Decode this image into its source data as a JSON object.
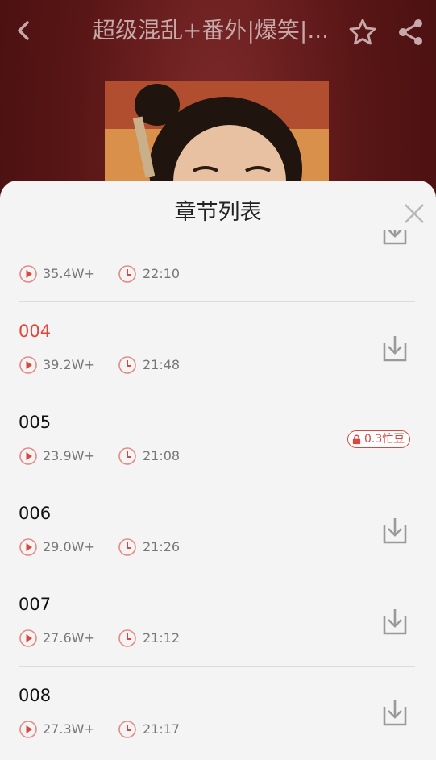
{
  "header": {
    "title": "超级混乱+番外|爆笑|...",
    "back_icon": "chevron-left-icon",
    "favorite_icon": "star-icon",
    "share_icon": "share-icon"
  },
  "sheet": {
    "title": "章节列表",
    "close_icon": "close-icon"
  },
  "episodes": [
    {
      "name": "",
      "plays": "35.4W+",
      "duration": "22:10",
      "active": false,
      "action": "download"
    },
    {
      "name": "004",
      "plays": "39.2W+",
      "duration": "21:48",
      "active": true,
      "action": "download"
    },
    {
      "name": "005",
      "plays": "23.9W+",
      "duration": "21:08",
      "active": false,
      "action": "locked",
      "price": "0.3忙豆"
    },
    {
      "name": "006",
      "plays": "29.0W+",
      "duration": "21:26",
      "active": false,
      "action": "download"
    },
    {
      "name": "007",
      "plays": "27.6W+",
      "duration": "21:12",
      "active": false,
      "action": "download"
    },
    {
      "name": "008",
      "plays": "27.3W+",
      "duration": "21:17",
      "active": false,
      "action": "download"
    }
  ],
  "colors": {
    "accent": "#e0453a",
    "header_bg": "#5a1616",
    "sheet_bg": "#f4f4f4"
  }
}
